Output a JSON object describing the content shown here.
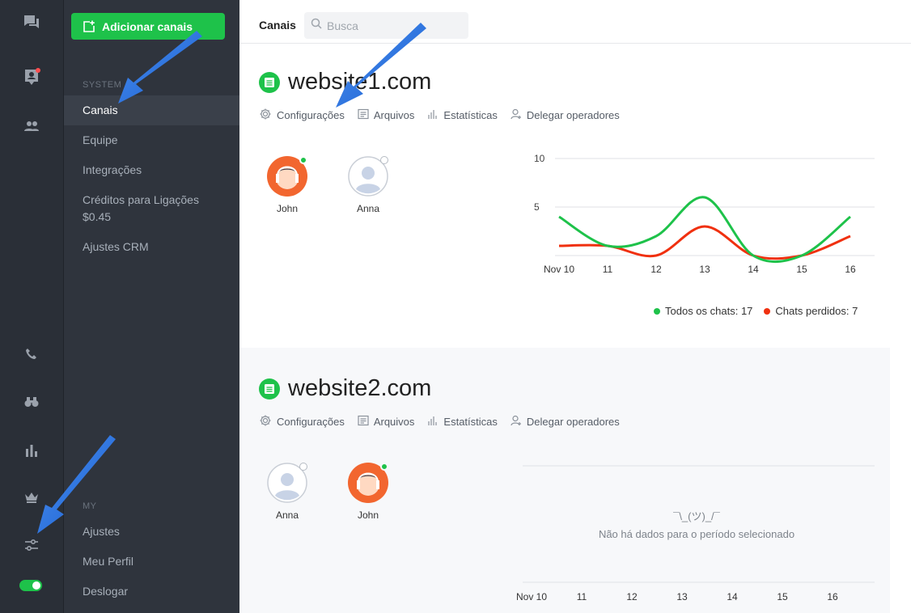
{
  "topbar": {
    "title": "Canais",
    "search_placeholder": "Busca"
  },
  "sidebar": {
    "add_button": "Adicionar canais",
    "system_label": "SYSTEM",
    "system_items": [
      "Canais",
      "Equipe",
      "Integrações",
      "Créditos para Ligações",
      "$0.45",
      "Ajustes CRM"
    ],
    "my_label": "MY",
    "my_items": [
      "Ajustes",
      "Meu Perfil",
      "Deslogar"
    ]
  },
  "rail": {
    "icons": [
      "chat-icon",
      "contacts-icon",
      "team-icon",
      "phone-icon",
      "binoculars-icon",
      "stats-icon",
      "crown-icon",
      "settings-sliders-icon"
    ],
    "has_notification": true,
    "online_toggle": true
  },
  "tabs": [
    "Configurações",
    "Arquivos",
    "Estatísticas",
    "Delegar operadores"
  ],
  "site1": {
    "name": "website1.com",
    "operators": [
      {
        "name": "John",
        "status": "online"
      },
      {
        "name": "Anna",
        "status": "offline"
      }
    ],
    "legend_all": "Todos os chats: 17",
    "legend_missed": "Chats perdidos: 7"
  },
  "site2": {
    "name": "website2.com",
    "operators": [
      {
        "name": "Anna",
        "status": "offline"
      },
      {
        "name": "John",
        "status": "online"
      }
    ],
    "shrug": "¯\\_(ツ)_/¯",
    "empty_text": "Não há dados para o período selecionado"
  },
  "colors": {
    "green": "#1ec24a",
    "red": "#f0300f",
    "rail_bg": "#2a2f37",
    "sidebar_bg": "#2f343d"
  },
  "chart_data": [
    {
      "type": "line",
      "x": [
        "Nov 10",
        "11",
        "12",
        "13",
        "14",
        "15",
        "16"
      ],
      "y_ticks": [
        5,
        10
      ],
      "ylim": [
        0,
        10
      ],
      "grid": true,
      "legend": "bottom-right",
      "series": [
        {
          "name": "Todos os chats: 17",
          "color": "#1ec24a",
          "values": [
            4,
            1,
            2,
            6,
            0,
            0,
            4
          ]
        },
        {
          "name": "Chats perdidos: 7",
          "color": "#f0300f",
          "values": [
            1,
            1,
            0,
            3,
            0,
            0,
            2
          ]
        }
      ]
    },
    {
      "type": "line",
      "x": [
        "Nov 10",
        "11",
        "12",
        "13",
        "14",
        "15",
        "16"
      ],
      "series": []
    }
  ]
}
